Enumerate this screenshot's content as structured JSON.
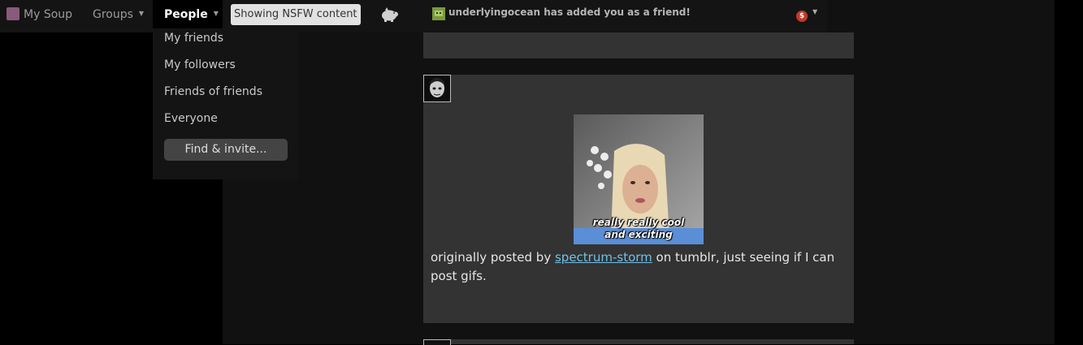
{
  "topbar": {
    "my_soup": "My Soup",
    "groups": "Groups",
    "people": "People",
    "nsfw_label": "Showing NSFW content",
    "icons": [
      "soup-logo-icon",
      "caret-down-icon",
      "pig-icon"
    ]
  },
  "people_menu": {
    "items": [
      "My friends",
      "My followers",
      "Friends of friends",
      "Everyone"
    ],
    "find_invite": "Find & invite..."
  },
  "notification": {
    "text": "underlyingocean has added you as a friend!",
    "badge": "$",
    "badge_color": "#c0392b"
  },
  "post": {
    "caption_line1": "really really cool",
    "caption_line2": "and exciting",
    "text_before": "originally posted by",
    "link_text": "spectrum-storm",
    "link_color": "#6fc1e8",
    "text_after": "on tumblr, just seeing if I can post gifs."
  }
}
